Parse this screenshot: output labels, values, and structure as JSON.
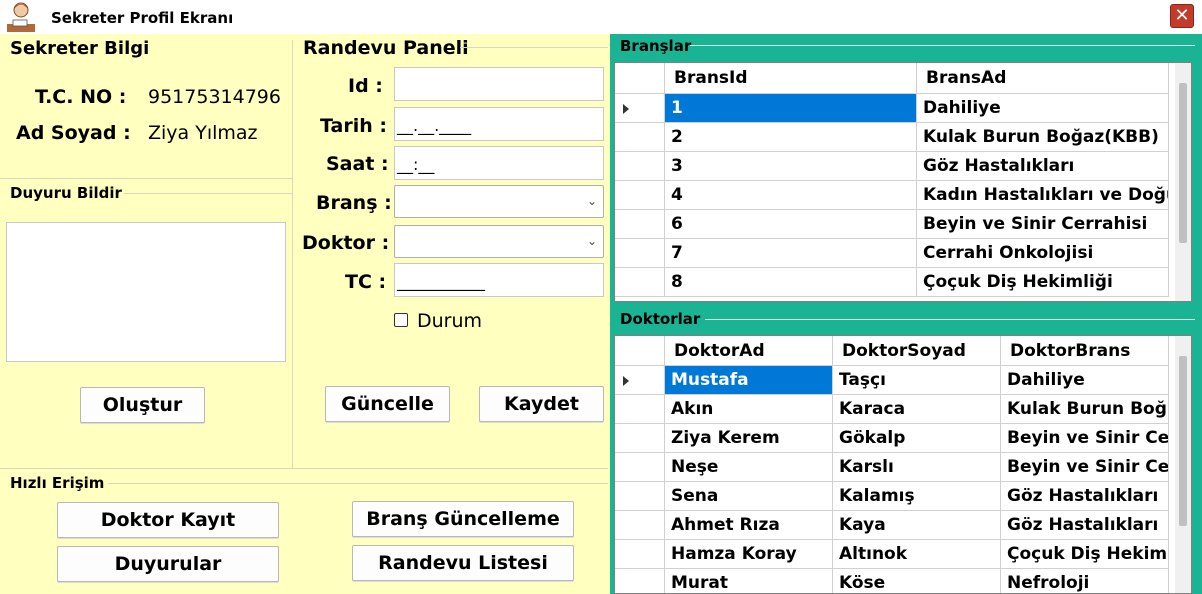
{
  "window": {
    "title": "Sekreter Profil Ekranı",
    "close_glyph": "✕"
  },
  "sekreter_bilgi": {
    "title": "Sekreter Bilgi",
    "tc_label": "T.C. NO :",
    "tc_value": "95175314796",
    "name_label": "Ad Soyad :",
    "name_value": "Ziya Yılmaz"
  },
  "duyuru": {
    "title": "Duyuru Bildir",
    "text_value": "",
    "create_button": "Oluştur"
  },
  "randevu": {
    "title": "Randevu Paneli",
    "id_label": "Id :",
    "id_value": "",
    "tarih_label": "Tarih :",
    "tarih_mask": "__.__.____",
    "saat_label": "Saat :",
    "saat_mask": "__:__",
    "brans_label": "Branş :",
    "brans_value": "",
    "doktor_label": "Doktor :",
    "doktor_value": "",
    "tc_label": "TC :",
    "tc_mask": "___________",
    "durum_label": "Durum",
    "durum_checked": false,
    "update_button": "Güncelle",
    "save_button": "Kaydet"
  },
  "hizli_erisim": {
    "title": "Hızlı Erişim",
    "doktor_kayit": "Doktor Kayıt",
    "brans_guncelleme": "Branş Güncelleme",
    "duyurular": "Duyurular",
    "randevu_listesi": "Randevu Listesi"
  },
  "branslar": {
    "title": "Branşlar",
    "columns": [
      "BransId",
      "BransAd"
    ],
    "selected_row": 0,
    "rows": [
      [
        "1",
        "Dahiliye"
      ],
      [
        "2",
        "Kulak Burun Boğaz(KBB)"
      ],
      [
        "3",
        "Göz Hastalıkları"
      ],
      [
        "4",
        "Kadın Hastalıkları ve Doğum"
      ],
      [
        "6",
        "Beyin ve Sinir Cerrahisi"
      ],
      [
        "7",
        "Cerrahi Onkolojisi"
      ],
      [
        "8",
        "Çoçuk Diş Hekimliği"
      ]
    ]
  },
  "doktorlar": {
    "title": "Doktorlar",
    "columns": [
      "DoktorAd",
      "DoktorSoyad",
      "DoktorBrans"
    ],
    "selected_row": 0,
    "rows": [
      [
        "Mustafa",
        "Taşçı",
        "Dahiliye"
      ],
      [
        "Akın",
        "Karaca",
        "Kulak Burun Boğ..."
      ],
      [
        "Ziya Kerem",
        "Gökalp",
        "Beyin ve Sinir Ce..."
      ],
      [
        "Neşe",
        "Karslı",
        "Beyin ve Sinir Ce..."
      ],
      [
        "Sena",
        "Kalamış",
        "Göz Hastalıkları"
      ],
      [
        "Ahmet Rıza",
        "Kaya",
        "Göz Hastalıkları"
      ],
      [
        "Hamza Koray",
        "Altınok",
        "Çoçuk Diş Hekim..."
      ],
      [
        "Murat",
        "Köse",
        "Nefroloji"
      ]
    ]
  },
  "colors": {
    "background": "#ffffc0",
    "panel_green": "#1ab394",
    "selection": "#0078d7",
    "close_red": "#c43b2b"
  }
}
